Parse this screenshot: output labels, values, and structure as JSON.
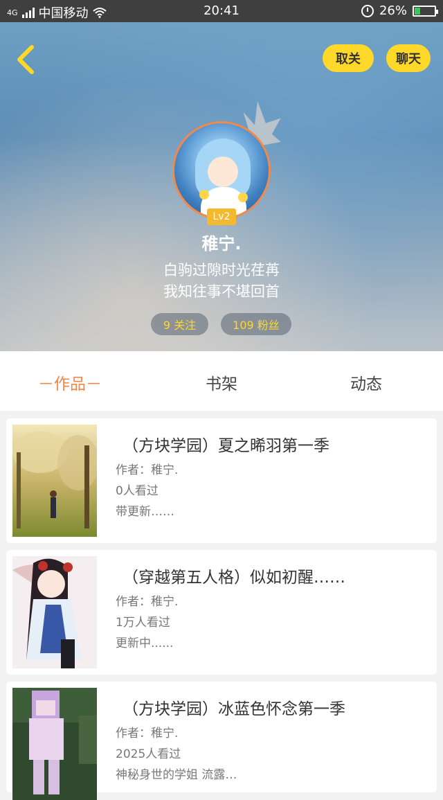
{
  "status_bar": {
    "network": "4G",
    "carrier": "中国移动",
    "time": "20:41",
    "battery": "26%",
    "battery_level": 0.26
  },
  "header": {
    "follow_button": "取关",
    "chat_button": "聊天",
    "level": "Lv2",
    "username": "稚宁.",
    "bio_line1": "白驹过隙时光荏苒",
    "bio_line2": "我知往事不堪回首",
    "following": "9 关注",
    "followers": "109 粉丝",
    "accent_color": "#ffd82a"
  },
  "tabs": [
    {
      "label": "－作品－",
      "active": true
    },
    {
      "label": "书架",
      "active": false
    },
    {
      "label": "动态",
      "active": false
    }
  ],
  "works": [
    {
      "title": "（方块学园）夏之晞羽第一季",
      "author": "作者：稚宁.",
      "views": "0人看过",
      "status": "带更新……"
    },
    {
      "title": "（穿越第五人格）似如初醒……",
      "author": "作者：稚宁.",
      "views": "1万人看过",
      "status": "更新中......"
    },
    {
      "title": "（方块学园）冰蓝色怀念第一季",
      "author": "作者：稚宁.",
      "views": "2025人看过",
      "status": "神秘身世的学姐 流露…"
    }
  ]
}
